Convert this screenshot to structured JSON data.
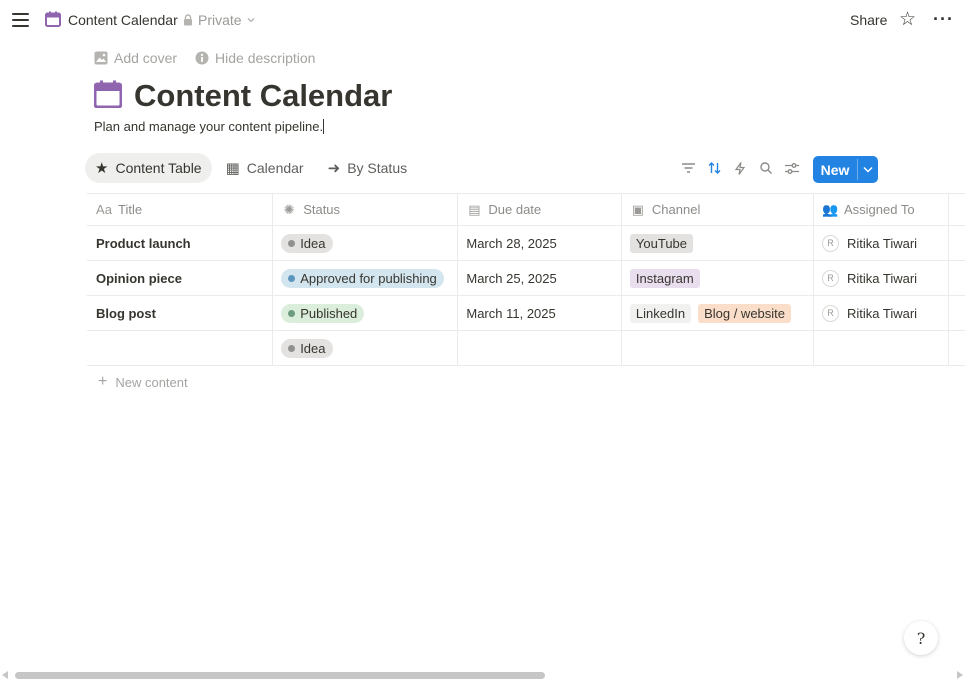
{
  "topbar": {
    "breadcrumb_title": "Content Calendar",
    "privacy_label": "Private",
    "share_label": "Share",
    "favorite_icon": "star-outline-icon",
    "more_icon": "more-horizontal-icon"
  },
  "page": {
    "add_cover_label": "Add cover",
    "hide_description_label": "Hide description",
    "title": "Content Calendar",
    "description": "Plan and manage your content pipeline.",
    "icon": "calendar-icon",
    "icon_color": "#9065b0"
  },
  "views": [
    {
      "label": "Content Table",
      "icon": "star-icon",
      "glyph": "★",
      "active": true
    },
    {
      "label": "Calendar",
      "icon": "calendar-grid-icon",
      "glyph": "▦",
      "active": false
    },
    {
      "label": "By Status",
      "icon": "arrow-right-icon",
      "glyph": "➜",
      "active": false
    }
  ],
  "toolbar": {
    "new_label": "New",
    "accent": "#2383e2"
  },
  "table": {
    "columns": [
      {
        "label": "Title",
        "icon": "text-icon",
        "glyph": "Aa"
      },
      {
        "label": "Status",
        "icon": "status-icon",
        "glyph": "✺"
      },
      {
        "label": "Due date",
        "icon": "calendar-icon",
        "glyph": "▤"
      },
      {
        "label": "Channel",
        "icon": "select-icon",
        "glyph": "▣"
      },
      {
        "label": "Assigned To",
        "icon": "people-icon",
        "glyph": "👥"
      }
    ],
    "rows": [
      {
        "title": "Product launch",
        "status": "Idea",
        "status_bg": "#e3e2e0",
        "status_dot": "#91918e",
        "due": "March 28, 2025",
        "channels": [
          {
            "label": "YouTube",
            "bg": "#e3e2e0"
          }
        ],
        "assignee_initial": "R",
        "assignee": "Ritika Tiwari"
      },
      {
        "title": "Opinion piece",
        "status": "Approved for publishing",
        "status_bg": "#d3e5ef",
        "status_dot": "#5b97bd",
        "due": "March 25, 2025",
        "channels": [
          {
            "label": "Instagram",
            "bg": "#e8deee"
          }
        ],
        "assignee_initial": "R",
        "assignee": "Ritika Tiwari"
      },
      {
        "title": "Blog post",
        "status": "Published",
        "status_bg": "#dbeddb",
        "status_dot": "#6c9b7d",
        "due": "March 11, 2025",
        "channels": [
          {
            "label": "LinkedIn",
            "bg": "#f1f1ef"
          },
          {
            "label": "Blog / website",
            "bg": "#fadec9"
          }
        ],
        "assignee_initial": "R",
        "assignee": "Ritika Tiwari"
      },
      {
        "title": "",
        "status": "Idea",
        "status_bg": "#e3e2e0",
        "status_dot": "#91918e",
        "due": "",
        "channels": [],
        "assignee_initial": "",
        "assignee": ""
      }
    ],
    "new_content_label": "New content"
  },
  "help_button": {
    "icon": "help-icon",
    "glyph": "?"
  }
}
